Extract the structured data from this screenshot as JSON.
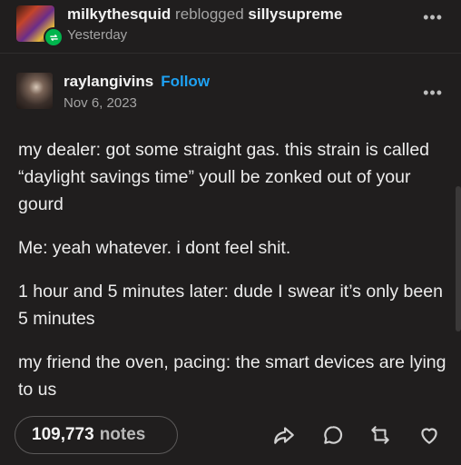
{
  "reblog_header": {
    "reblogger": "milkythesquid",
    "action": "reblogged",
    "source_blog": "sillysupreme",
    "time": "Yesterday",
    "more_icon": "more-dots-icon"
  },
  "original_post": {
    "author": "raylangivins",
    "follow_label": "Follow",
    "date": "Nov 6, 2023",
    "more_icon": "more-dots-icon",
    "paragraphs": [
      "my dealer: got some straight gas. this strain is called “daylight savings time” youll be zonked out of your gourd",
      "Me: yeah whatever. i dont feel shit.",
      "1 hour and 5 minutes later: dude I swear it’s only been 5 minutes",
      "my friend the oven, pacing: the smart devices are lying to us"
    ]
  },
  "footer": {
    "notes_count": "109,773",
    "notes_label": "notes",
    "actions": [
      "share-icon",
      "reply-icon",
      "reblog-icon",
      "like-icon"
    ]
  },
  "colors": {
    "background": "#201e1e",
    "accent_follow": "#1ea1f2",
    "reblog_badge": "#00b54d"
  }
}
